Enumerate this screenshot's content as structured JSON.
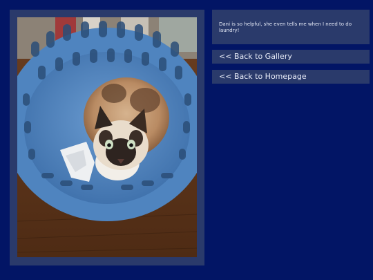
{
  "photo": {
    "subject": "cat sitting in a blue laundry basket"
  },
  "caption": {
    "text": "Dani is so helpful, she even tells me when I need to do laundry!"
  },
  "nav": {
    "back_to_gallery": "<< Back to Gallery",
    "back_to_homepage": "<< Back to Homepage"
  }
}
